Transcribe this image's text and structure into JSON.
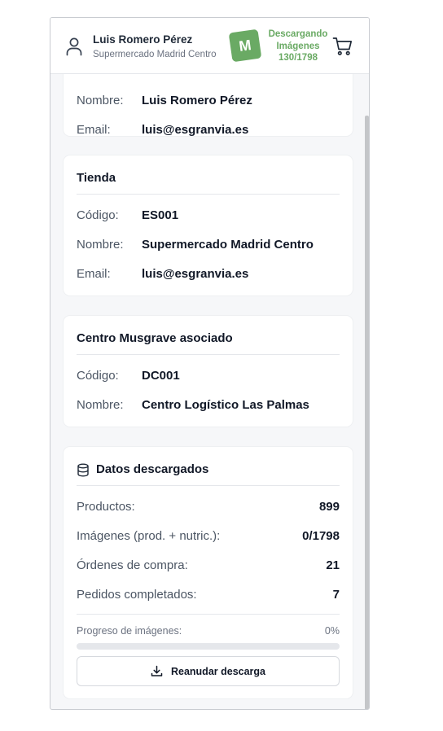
{
  "header": {
    "user_name": "Luis Romero Pérez",
    "store_name": "Supermercado Madrid Centro",
    "logo_letter": "M",
    "download_status": [
      "Descargando",
      "Imágenes",
      "130/1798"
    ],
    "icons": [
      "user-icon",
      "cart-icon"
    ]
  },
  "user_card": {
    "name_label": "Nombre:",
    "name_value": "Luis Romero Pérez",
    "email_label": "Email:",
    "email_value": "luis@esgranvia.es"
  },
  "store_card": {
    "title": "Tienda",
    "code_label": "Código:",
    "code_value": "ES001",
    "name_label": "Nombre:",
    "name_value": "Supermercado Madrid Centro",
    "email_label": "Email:",
    "email_value": "luis@esgranvia.es"
  },
  "center_card": {
    "title": "Centro Musgrave asociado",
    "code_label": "Código:",
    "code_value": "DC001",
    "name_label": "Nombre:",
    "name_value": "Centro Logístico Las Palmas"
  },
  "data_card": {
    "title": "Datos descargados",
    "icon": "database-icon",
    "rows": [
      {
        "label": "Productos:",
        "value": "899"
      },
      {
        "label": "Imágenes (prod. + nutric.):",
        "value": "0/1798"
      },
      {
        "label": "Órdenes de compra:",
        "value": "21"
      },
      {
        "label": "Pedidos completados:",
        "value": "7"
      }
    ],
    "progress_label": "Progreso de imágenes:",
    "progress_text": "0%",
    "progress_value": 0,
    "resume_button": "Reanudar descarga"
  },
  "colors": {
    "accent": "#6aaa64",
    "background": "#f6f7f9"
  }
}
